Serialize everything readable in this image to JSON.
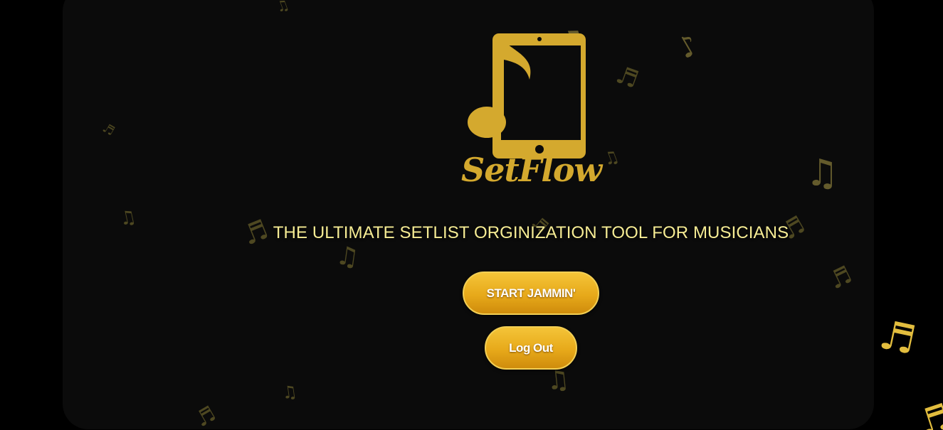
{
  "colors": {
    "page_background": "#000000",
    "card_background": "#0b0b0b",
    "brand_gold": "#d4a92e",
    "tagline": "#f6ec94",
    "button_gradient_top": "#f4c438",
    "button_gradient_bottom": "#cf8c0c",
    "button_text": "#ffffff"
  },
  "brand": {
    "name": "SetFlow",
    "logo_icon": "tablet-music-note-icon"
  },
  "tagline": "THE ULTIMATE SETLIST ORGINIZATION TOOL FOR MUSICIANS",
  "actions": {
    "start_label": "START JAMMIN'",
    "logout_label": "Log Out"
  },
  "background_notes_icon": "music-note-icon"
}
